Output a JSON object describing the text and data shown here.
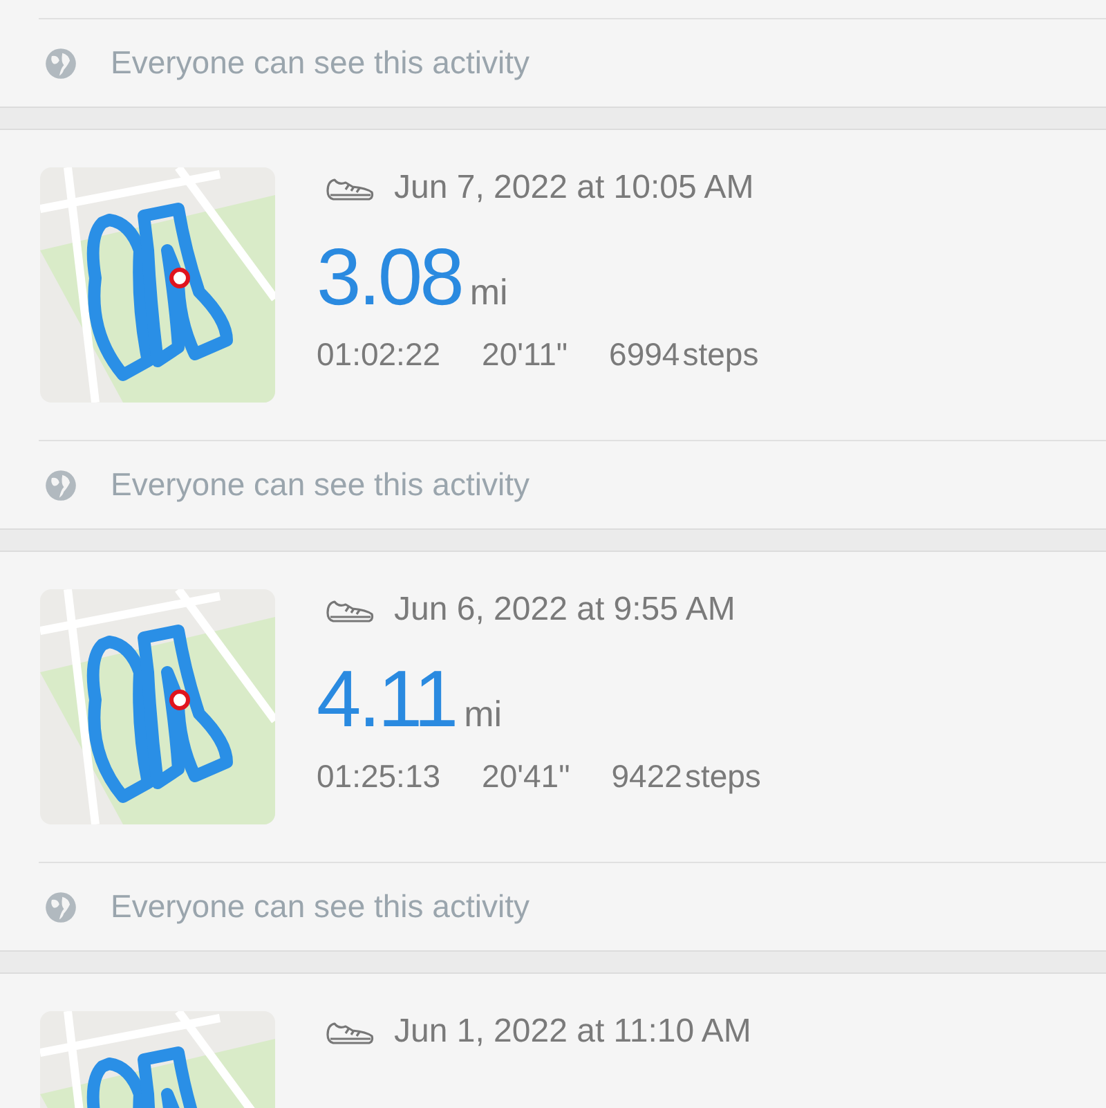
{
  "activities": [
    {
      "visibility": "Everyone can see this activity"
    },
    {
      "date": "Jun 7, 2022 at 10:05 AM",
      "distance": "3.08",
      "unit": "mi",
      "duration": "01:02:22",
      "pace": "20'11\"",
      "steps": "6994",
      "steps_unit": "steps",
      "visibility": "Everyone can see this activity"
    },
    {
      "date": "Jun 6, 2022 at 9:55 AM",
      "distance": "4.11",
      "unit": "mi",
      "duration": "01:25:13",
      "pace": "20'41\"",
      "steps": "9422",
      "steps_unit": "steps",
      "visibility": "Everyone can see this activity"
    },
    {
      "date": "Jun 1, 2022 at 11:10 AM"
    }
  ]
}
